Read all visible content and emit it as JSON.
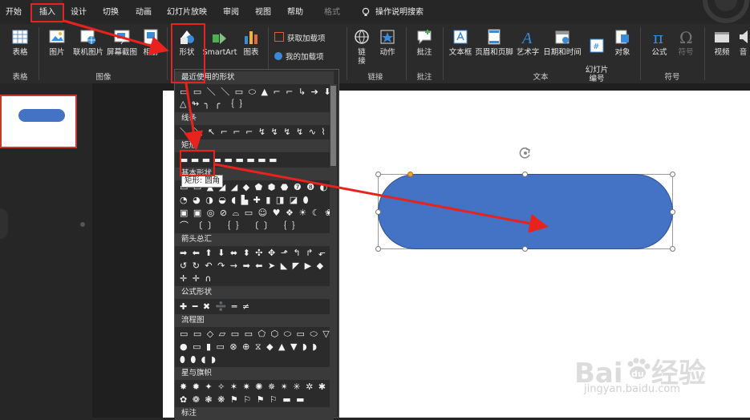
{
  "tabs": [
    "开始",
    "插入",
    "设计",
    "切换",
    "动画",
    "幻灯片放映",
    "审阅",
    "视图",
    "帮助",
    "格式"
  ],
  "active_tab": "插入",
  "search_hint": "操作说明搜索",
  "ribbon": {
    "table": {
      "label": "表格",
      "group": "表格"
    },
    "images": {
      "picture": "图片",
      "online_picture": "联机图片",
      "screenshot": "屏幕截图",
      "album": "相册",
      "group": "图像"
    },
    "illustrations": {
      "shapes": "形状",
      "smartart": "SmartArt",
      "chart": "图表"
    },
    "addins": {
      "get": "获取加载项",
      "mine": "我的加载项"
    },
    "links": {
      "link": "链接",
      "action": "动作",
      "group": "链接"
    },
    "comments": {
      "comment": "批注",
      "group": "批注"
    },
    "text": {
      "textbox": "文本框",
      "header_footer": "页眉和页脚",
      "wordart": "艺术字",
      "datetime": "日期和时间",
      "slide_number": "幻灯片\n编号",
      "object": "对象",
      "group": "文本"
    },
    "symbols": {
      "equation": "公式",
      "symbol": "符号",
      "group": "符号"
    },
    "media": {
      "video": "视频",
      "audio": "音"
    }
  },
  "shapes_dropdown": {
    "sections": [
      "最近使用的形状",
      "线条",
      "矩形",
      "基本形状",
      "箭头总汇",
      "公式形状",
      "流程图",
      "星与旗帜",
      "标注"
    ],
    "tooltip": "圆角",
    "tooltip_prefix": "矩形:",
    "rows": {
      "recent1": "▭ ▭ ＼ ＼ ▭ ⬭ ▲ ⌐ ⌐ ↳ ➔ ⬇",
      "recent2": "△ ↬ ╮ ╭ ｛ ｝",
      "lines": "＼ ＼ ↖ ⌐ ⌐ ⌐ ↯ ↯ ↯ ↯ ∿ ⌇",
      "rect": "▬ ▬ ▬ ▬ ▬ ▬ ▬ ▬ ▬",
      "basic1": "▭ ▭ ▲ ◢ ◢ ◆ ⬟ ⬢ ⬣ ❼ ❽ ◐",
      "basic2": "◔ ◕ ◑ ◒ ◖ ▙ ✚ ▮ ◨ ◪ ⬮",
      "basic3": "▣ ▣ ◎ ⊘ ⌓ ▭ ☺ ♥ ❖ ☀ ☾ ❀",
      "basic4": "⌒ 〔 〕 ｛ ｝ 〔 〕 ｛ ｝",
      "arrows1": "➡ ⬅ ⬆ ⬇ ⬌ ⬍ ✣ ✥ ⬏ ↰ ↱ ⬐",
      "arrows2": "↺ ↻ ↶ ↷ ⇝ ➡ ⬅ ➤ ◣ ◤ ▶ ◆",
      "arrows3": "✛ ✛ ∩",
      "math": "✚ ━ ✖ ➗ ═ ≠",
      "flow1": "▭ ▭ ◇ ▱ ▭ ▭ ⬠ ⬡ ⬭ ▭ ⬭ ▽",
      "flow2": "● ▭ ▮ ▭ ⊗ ⊕ ⧖ ◆ ▲ ▼ ◗ ◗",
      "flow3": "⬮ ⬮ ◖ ◗",
      "stars1": "✸ ✹ ✦ ✧ ✶ ✷ ✺ ✵ ✴ ✳ ✲ ✱",
      "stars2": "✿ ❁ ❃ ❋ ⚑ ⚐ ⚑ ⚐ ▬ ▬"
    }
  },
  "watermark": {
    "main": "Bai   经验",
    "du": "du",
    "sub": "jingyan.baidu.com"
  },
  "colors": {
    "accent": "#4472C4",
    "highlight": "#E8221D",
    "ribbon_bg": "#2B2B2B",
    "slide_bg": "#FFFFFF"
  }
}
